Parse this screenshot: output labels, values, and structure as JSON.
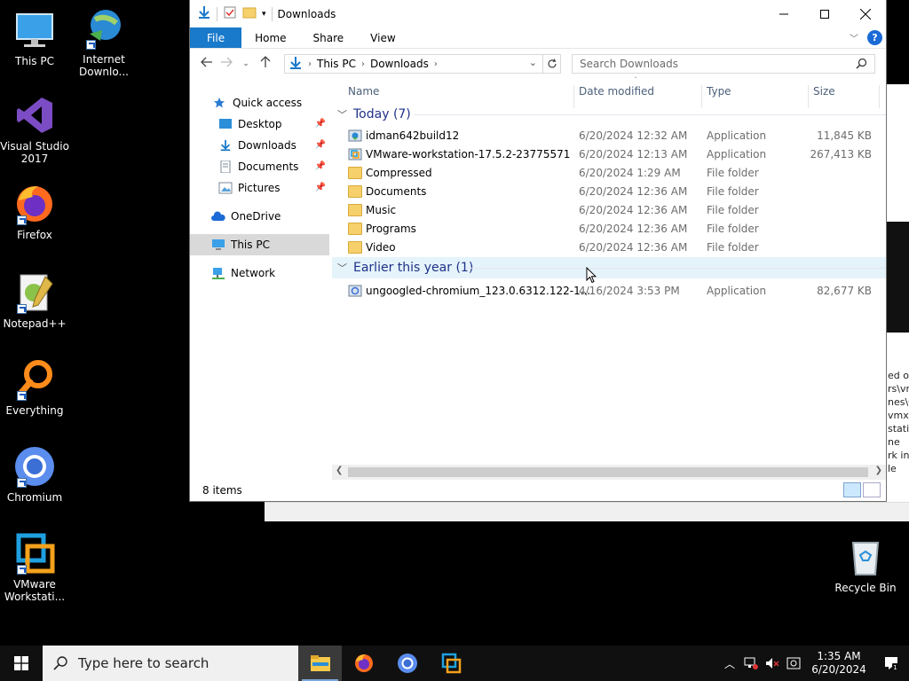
{
  "desktop": {
    "icons": [
      {
        "label": "This PC"
      },
      {
        "label": "Internet Downlo..."
      },
      {
        "label": "Visual Studio 2017"
      },
      {
        "label": "Firefox"
      },
      {
        "label": "Notepad++"
      },
      {
        "label": "Everything"
      },
      {
        "label": "Chromium"
      },
      {
        "label": "VMware Workstati..."
      },
      {
        "label": "Recycle Bin"
      }
    ],
    "bg_text_lines": [
      "ed of",
      "rs\\vn",
      "nes\\C",
      "vmx",
      "station",
      "ne",
      "rk inf",
      "le"
    ]
  },
  "explorer": {
    "title": "Downloads",
    "ribbon_tabs": [
      "File",
      "Home",
      "Share",
      "View"
    ],
    "help_label": "?",
    "address": {
      "segments": [
        "This PC",
        "Downloads"
      ]
    },
    "search": {
      "placeholder": "Search Downloads"
    },
    "nav": {
      "quick_access": "Quick access",
      "desktop": "Desktop",
      "downloads": "Downloads",
      "documents": "Documents",
      "pictures": "Pictures",
      "onedrive": "OneDrive",
      "thispc": "This PC",
      "network": "Network"
    },
    "columns": {
      "name": "Name",
      "date": "Date modified",
      "type": "Type",
      "size": "Size"
    },
    "groups": [
      {
        "label": "Today (7)",
        "files": [
          {
            "name": "idman642build12",
            "date": "6/20/2024 12:32 AM",
            "type": "Application",
            "size": "11,845 KB"
          },
          {
            "name": "VMware-workstation-17.5.2-23775571",
            "date": "6/20/2024 12:13 AM",
            "type": "Application",
            "size": "267,413 KB"
          },
          {
            "name": "Compressed",
            "date": "6/20/2024 1:29 AM",
            "type": "File folder",
            "size": ""
          },
          {
            "name": "Documents",
            "date": "6/20/2024 12:36 AM",
            "type": "File folder",
            "size": ""
          },
          {
            "name": "Music",
            "date": "6/20/2024 12:36 AM",
            "type": "File folder",
            "size": ""
          },
          {
            "name": "Programs",
            "date": "6/20/2024 12:36 AM",
            "type": "File folder",
            "size": ""
          },
          {
            "name": "Video",
            "date": "6/20/2024 12:36 AM",
            "type": "File folder",
            "size": ""
          }
        ]
      },
      {
        "label": "Earlier this year (1)",
        "files": [
          {
            "name": "ungoogled-chromium_123.0.6312.122-1....",
            "date": "4/16/2024 3:53 PM",
            "type": "Application",
            "size": "82,677 KB"
          }
        ]
      }
    ],
    "status": "8 items"
  },
  "taskbar": {
    "search_placeholder": "Type here to search",
    "time": "1:35 AM",
    "date": "6/20/2024"
  },
  "colors": {
    "file_tab": "#1979ca",
    "group_text": "#1e3287",
    "taskbar": "#101010"
  }
}
